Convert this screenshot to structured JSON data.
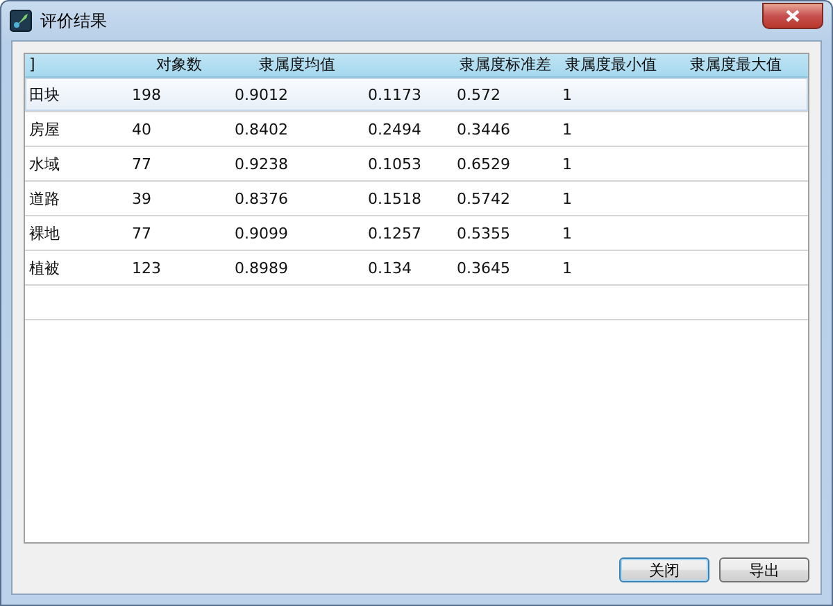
{
  "window": {
    "title": "评价结果"
  },
  "table": {
    "columns": [
      "]",
      "对象数",
      "隶属度均值",
      "",
      "隶属度标准差",
      "隶属度最小值",
      "隶属度最大值"
    ],
    "rows": [
      {
        "selected": true,
        "cells": [
          "田块",
          "198",
          "0.9012",
          "0.1173",
          "0.572",
          "1"
        ]
      },
      {
        "selected": false,
        "cells": [
          "房屋",
          "40",
          "0.8402",
          "0.2494",
          "0.3446",
          "1"
        ]
      },
      {
        "selected": false,
        "cells": [
          "水域",
          "77",
          "0.9238",
          "0.1053",
          "0.6529",
          "1"
        ]
      },
      {
        "selected": false,
        "cells": [
          "道路",
          "39",
          "0.8376",
          "0.1518",
          "0.5742",
          "1"
        ]
      },
      {
        "selected": false,
        "cells": [
          "裸地",
          "77",
          "0.9099",
          "0.1257",
          "0.5355",
          "1"
        ]
      },
      {
        "selected": false,
        "cells": [
          "植被",
          "123",
          "0.8989",
          "0.134",
          "0.3645",
          "1"
        ]
      }
    ]
  },
  "buttons": [
    {
      "label": "关闭",
      "focused": true
    },
    {
      "label": "导出",
      "focused": false
    }
  ]
}
